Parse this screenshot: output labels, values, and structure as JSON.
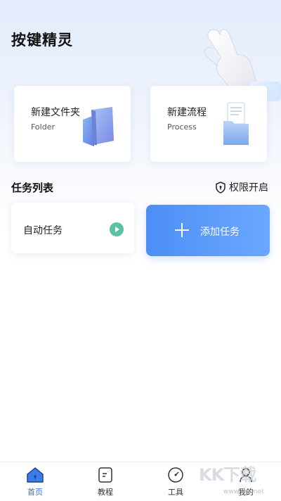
{
  "app": {
    "title": "按键精灵"
  },
  "cards": {
    "folder": {
      "title": "新建文件夹",
      "subtitle": "Folder"
    },
    "process": {
      "title": "新建流程",
      "subtitle": "Process"
    }
  },
  "tasks": {
    "section_title": "任务列表",
    "permission_label": "权限开启",
    "auto_task_label": "自动任务",
    "add_task_label": "添加任务"
  },
  "tabbar": {
    "items": [
      {
        "label": "首页",
        "icon": "home-icon",
        "active": true
      },
      {
        "label": "教程",
        "icon": "tutorial-icon",
        "active": false
      },
      {
        "label": "工具",
        "icon": "tools-icon",
        "active": false
      },
      {
        "label": "我的",
        "icon": "profile-icon",
        "active": false
      }
    ]
  },
  "colors": {
    "accent": "#2f6fe0",
    "add_button": "#5a9bf8",
    "play": "#5cc2a2"
  },
  "watermark": {
    "text": "KK下载",
    "url": "www.kkx.net"
  }
}
